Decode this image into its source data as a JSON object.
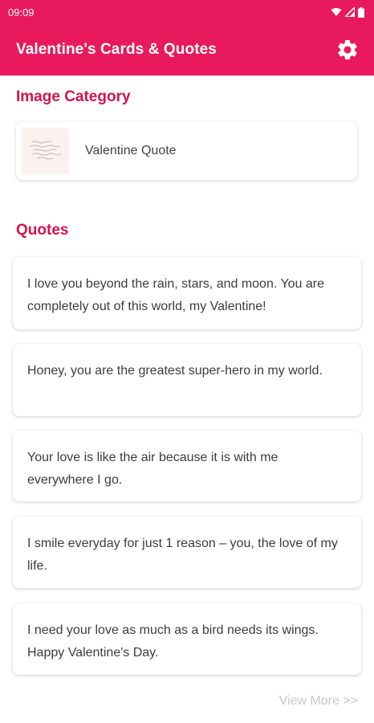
{
  "status_bar": {
    "time": "09:09"
  },
  "app_bar": {
    "title": "Valentine's Cards & Quotes",
    "settings_icon": "gear-icon"
  },
  "image_category": {
    "title": "Image Category",
    "items": [
      {
        "label": "Valentine Quote"
      }
    ]
  },
  "quotes": {
    "title": "Quotes",
    "items": [
      {
        "text": "I love you beyond the rain, stars, and moon. You are completely out of this world, my Valentine!"
      },
      {
        "text": "Honey, you are the greatest super-hero in my world."
      },
      {
        "text": "Your love is like the air because it is with me everywhere I go."
      },
      {
        "text": "I smile everyday for just 1 reason – you, the love of my life."
      },
      {
        "text": "I need your love as much as a bird needs its wings. Happy Valentine's Day."
      }
    ],
    "view_more": "View More >>"
  },
  "colors": {
    "primary": "#e8195c",
    "section_title": "#d4134f",
    "view_more": "#c8c8c8"
  }
}
